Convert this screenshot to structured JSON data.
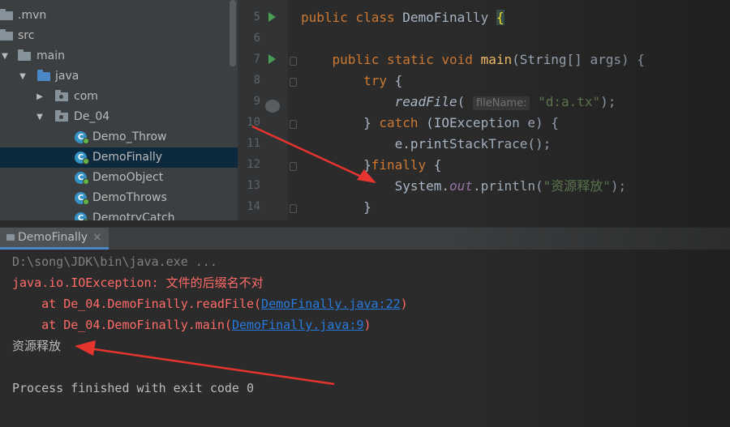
{
  "project_tree": {
    "items": [
      {
        "label": ".mvn",
        "kind": "folder-grey"
      },
      {
        "label": "src",
        "kind": "folder-grey"
      },
      {
        "label": "main",
        "kind": "folder-grey",
        "expanded": true
      },
      {
        "label": "java",
        "kind": "folder-blue",
        "expanded": true
      },
      {
        "label": "com",
        "kind": "package",
        "expanded": false
      },
      {
        "label": "De_04",
        "kind": "package",
        "expanded": true
      },
      {
        "label": "Demo_Throw",
        "kind": "class"
      },
      {
        "label": "DemoFinally",
        "kind": "class",
        "selected": true
      },
      {
        "label": "DemoObject",
        "kind": "class"
      },
      {
        "label": "DemoThrows",
        "kind": "class"
      },
      {
        "label": "DemotryCatch",
        "kind": "class"
      }
    ]
  },
  "editor": {
    "line_numbers": [
      "5",
      "6",
      "7",
      "8",
      "9",
      "10",
      "11",
      "12",
      "13",
      "14"
    ],
    "code": {
      "l5": {
        "kw1": "public",
        "kw2": "class",
        "name": "DemoFinally",
        "brace": "{"
      },
      "l7": {
        "kw1": "public",
        "kw2": "static",
        "kw3": "void",
        "fn": "main",
        "rest": "(String[] args) {"
      },
      "l8": {
        "kw": "try",
        "rest": " {"
      },
      "l9": {
        "fn": "readFile",
        "open": "(",
        "hint": "fileName:",
        "str": "\"d:a.tx\"",
        "close": ");"
      },
      "l10": {
        "pre": "} ",
        "kw": "catch",
        "rest": " (IOException e) {"
      },
      "l11": {
        "text": "e.printStackTrace();"
      },
      "l12": {
        "pre": "}",
        "kw": "finally",
        "rest": " {"
      },
      "l13": {
        "pre": "System.",
        "field": "out",
        "mid": ".println(",
        "str": "\"资源释放\"",
        "close": ");"
      },
      "l14": {
        "text": "}"
      }
    }
  },
  "run_panel": {
    "tab_label": "DemoFinally",
    "close_glyph": "×",
    "lines": {
      "cmd": "D:\\song\\JDK\\bin\\java.exe ...",
      "exception": "java.io.IOException: 文件的后缀名不对",
      "at1_pre": "    at De_04.DemoFinally.readFile(",
      "at1_link": "DemoFinally.java:22",
      "at1_post": ")",
      "at2_pre": "    at De_04.DemoFinally.main(",
      "at2_link": "DemoFinally.java:9",
      "at2_post": ")",
      "output": "资源释放",
      "exit": "Process finished with exit code 0"
    }
  },
  "colors": {
    "keyword": "#cc7832",
    "method": "#ffc66d",
    "string": "#6a8759",
    "error": "#ff6b68",
    "link": "#287bde",
    "annotation_arrow": "#e8342f"
  }
}
